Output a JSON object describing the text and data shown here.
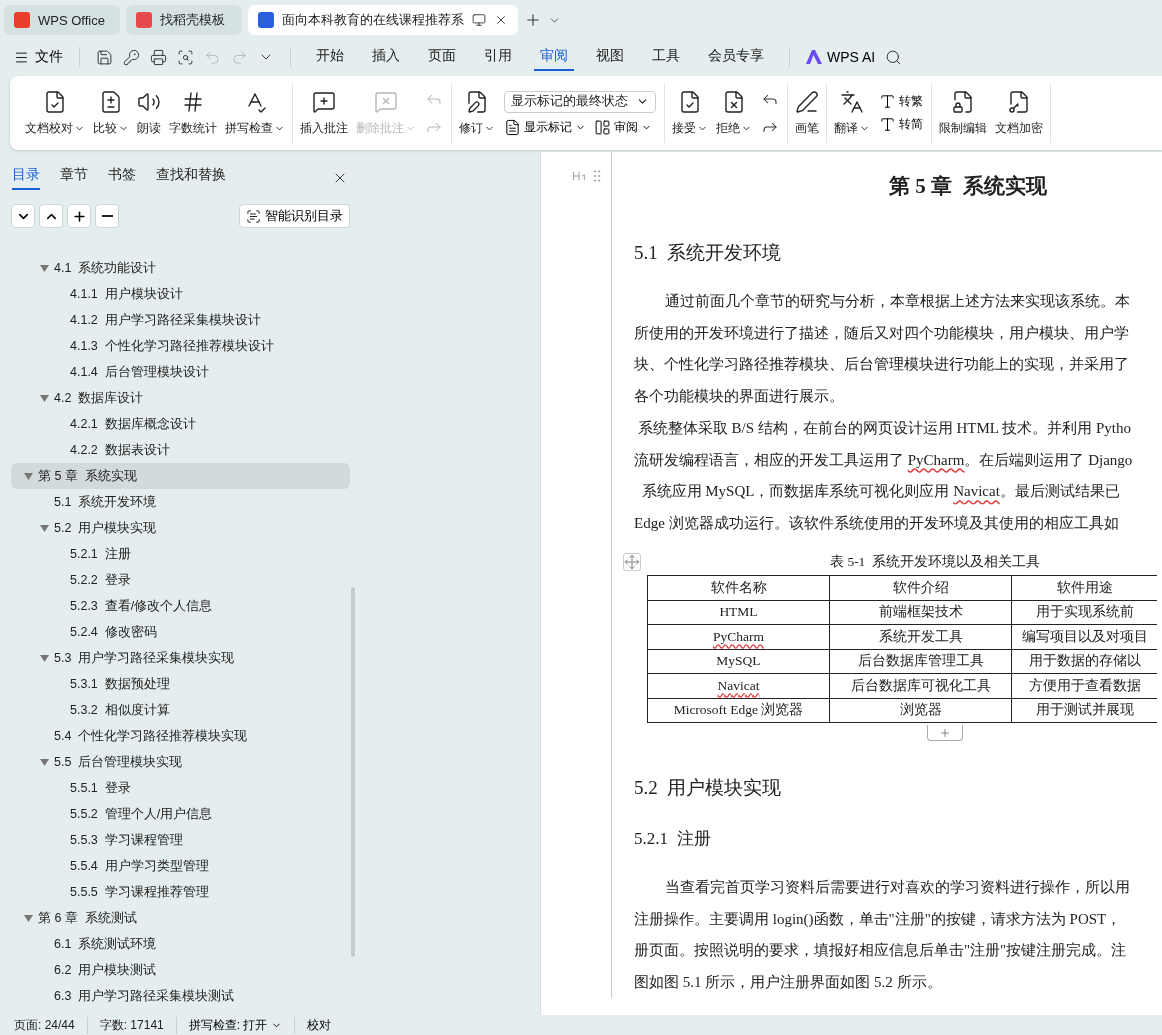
{
  "app_tabs": [
    {
      "label": "WPS Office",
      "kind": "home",
      "selected": false
    },
    {
      "label": "找稻壳模板",
      "kind": "template",
      "selected": false
    },
    {
      "label": "面向本科教育的在线课程推荐系",
      "kind": "document",
      "selected": true
    }
  ],
  "menu": {
    "file": "文件",
    "tabs": [
      {
        "label": "开始",
        "selected": false
      },
      {
        "label": "插入",
        "selected": false
      },
      {
        "label": "页面",
        "selected": false
      },
      {
        "label": "引用",
        "selected": false
      },
      {
        "label": "审阅",
        "selected": true
      },
      {
        "label": "视图",
        "selected": false
      },
      {
        "label": "工具",
        "selected": false
      },
      {
        "label": "会员专享",
        "selected": false
      }
    ],
    "ai": "WPS AI"
  },
  "ribbon": [
    {
      "items": [
        {
          "kind": "large",
          "label": "文档校对",
          "dropdown": true,
          "disabled": false
        },
        {
          "kind": "large",
          "label": "比较",
          "dropdown": true,
          "disabled": false
        },
        {
          "kind": "large",
          "label": "朗读",
          "dropdown": false,
          "disabled": false
        },
        {
          "kind": "large",
          "label": "字数统计",
          "dropdown": false,
          "disabled": false
        },
        {
          "kind": "large",
          "label": "拼写检查",
          "dropdown": true,
          "disabled": false
        }
      ]
    },
    {
      "items": [
        {
          "kind": "large",
          "label": "插入批注",
          "dropdown": false,
          "disabled": false
        },
        {
          "kind": "large",
          "label": "删除批注",
          "dropdown": true,
          "disabled": true
        },
        {
          "kind": "pair",
          "disabled": true
        }
      ]
    },
    {
      "items": [
        {
          "kind": "large",
          "label": "修订",
          "dropdown": true,
          "disabled": false
        },
        {
          "kind": "stack",
          "rows": [
            [
              {
                "kind": "select",
                "value": "显示标记的最终状态"
              }
            ],
            [
              {
                "kind": "small",
                "label": "显示标记",
                "dropdown": true
              },
              {
                "kind": "small",
                "label": "审阅",
                "dropdown": true
              }
            ]
          ]
        }
      ]
    },
    {
      "items": [
        {
          "kind": "large",
          "label": "接受",
          "dropdown": true,
          "disabled": false
        },
        {
          "kind": "large",
          "label": "拒绝",
          "dropdown": true,
          "disabled": false
        },
        {
          "kind": "pair",
          "disabled": false
        }
      ]
    },
    {
      "items": [
        {
          "kind": "large",
          "label": "画笔",
          "dropdown": false,
          "disabled": false
        }
      ]
    },
    {
      "items": [
        {
          "kind": "large",
          "label": "翻译",
          "dropdown": true,
          "disabled": false
        },
        {
          "kind": "stack",
          "rows": [
            [
              {
                "kind": "small",
                "label": "转繁",
                "dropdown": false
              }
            ],
            [
              {
                "kind": "small",
                "label": "转简",
                "dropdown": false
              }
            ]
          ]
        }
      ]
    },
    {
      "items": [
        {
          "kind": "large",
          "label": "限制编辑",
          "dropdown": false,
          "disabled": false
        },
        {
          "kind": "large",
          "label": "文档加密",
          "dropdown": false,
          "disabled": false
        }
      ]
    }
  ],
  "sidebar": {
    "tabs": [
      {
        "label": "目录",
        "selected": true
      },
      {
        "label": "章节",
        "selected": false
      },
      {
        "label": "书签",
        "selected": false
      },
      {
        "label": "查找和替换",
        "selected": false
      }
    ],
    "smart_button": "智能识别目录",
    "toc": [
      {
        "children": [
          {
            "label": "4.1  系统功能设计",
            "expanded": true,
            "selected": false,
            "children": [
              {
                "label": "4.1.1  用户模块设计",
                "selected": false
              },
              {
                "label": "4.1.2  用户学习路径采集模块设计",
                "selected": false
              },
              {
                "label": "4.1.3  个性化学习路径推荐模块设计",
                "selected": false
              },
              {
                "label": "4.1.4  后台管理模块设计",
                "selected": false
              }
            ]
          },
          {
            "label": "4.2  数据库设计",
            "expanded": true,
            "selected": false,
            "children": [
              {
                "label": "4.2.1  数据库概念设计",
                "selected": false
              },
              {
                "label": "4.2.2  数据表设计",
                "selected": false
              }
            ]
          }
        ]
      },
      {
        "label": "第 5 章  系统实现",
        "expanded": true,
        "selected": true,
        "children": [
          {
            "label": "5.1  系统开发环境",
            "selected": false
          },
          {
            "label": "5.2  用户模块实现",
            "expanded": true,
            "selected": false,
            "children": [
              {
                "label": "5.2.1  注册",
                "selected": false
              },
              {
                "label": "5.2.2  登录",
                "selected": false
              },
              {
                "label": "5.2.3  查看/修改个人信息",
                "selected": false
              },
              {
                "label": "5.2.4  修改密码",
                "selected": false
              }
            ]
          },
          {
            "label": "5.3  用户学习路径采集模块实现",
            "expanded": true,
            "selected": false,
            "children": [
              {
                "label": "5.3.1  数据预处理",
                "selected": false
              },
              {
                "label": "5.3.2  相似度计算",
                "selected": false
              }
            ]
          },
          {
            "label": "5.4  个性化学习路径推荐模块实现",
            "selected": false
          },
          {
            "label": "5.5  后台管理模块实现",
            "expanded": true,
            "selected": false,
            "children": [
              {
                "label": "5.5.1  登录",
                "selected": false
              },
              {
                "label": "5.5.2  管理个人/用户信息",
                "selected": false
              },
              {
                "label": "5.5.3  学习课程管理",
                "selected": false
              },
              {
                "label": "5.5.4  用户学习类型管理",
                "selected": false
              },
              {
                "label": "5.5.5  学习课程推荐管理",
                "selected": false
              }
            ]
          }
        ]
      },
      {
        "label": "第 6 章  系统测试",
        "expanded": true,
        "selected": false,
        "children": [
          {
            "label": "6.1  系统测试环境",
            "selected": false
          },
          {
            "label": "6.2  用户模块测试",
            "selected": false
          },
          {
            "label": "6.3  用户学习路径采集模块测试",
            "selected": false
          }
        ]
      }
    ]
  },
  "document": {
    "blocks": [
      {
        "kind": "chapter",
        "text": "第 5 章  系统实现"
      },
      {
        "kind": "section",
        "text": "5.1  系统开发环境"
      },
      {
        "kind": "paragraph",
        "lines": [
          {
            "indent": true,
            "segments": [
              {
                "text": "通过前面几个章节的研究与分析，本章根据上述方法来实现该系统。本"
              }
            ]
          },
          {
            "segments": [
              {
                "text": "所使用的开发环境进行了描述，随后又对四个功能模块，用户模块、用户学"
              }
            ]
          },
          {
            "segments": [
              {
                "text": "块、个性化学习路径推荐模块、后台管理模块进行功能上的实现，并采用了"
              }
            ]
          },
          {
            "segments": [
              {
                "text": "各个功能模块的界面进行展示。"
              }
            ]
          }
        ]
      },
      {
        "kind": "paragraph",
        "lines": [
          {
            "segments": [
              {
                "text": " 系统整体采取 B/S 结构，在前台的网页设计运用 HTML 技术。并利用 Pytho"
              }
            ]
          },
          {
            "segments": [
              {
                "text": "流研发编程语言，相应的开发工具运用了 "
              },
              {
                "text": "PyCharm",
                "misspelled": true
              },
              {
                "text": "。在后端则运用了 Django"
              }
            ]
          },
          {
            "segments": [
              {
                "text": "  系统应用 MySQL，而数据库系统可视化则应用 "
              },
              {
                "text": "Navicat",
                "misspelled": true
              },
              {
                "text": "。最后测试结果已"
              }
            ]
          },
          {
            "segments": [
              {
                "text": "Edge 浏览器成功运行。该软件系统使用的开发环境及其使用的相应工具如"
              }
            ]
          }
        ]
      },
      {
        "kind": "table",
        "caption": "表 5-1  系统开发环境以及相关工具",
        "columns": [
          "软件名称",
          "软件介绍",
          "软件用途"
        ],
        "rows": [
          [
            {
              "text": "HTML",
              "misspelled": false
            },
            {
              "text": "前端框架技术",
              "misspelled": false
            },
            {
              "text": "用于实现系统前",
              "misspelled": false
            }
          ],
          [
            {
              "text": "PyCharm",
              "misspelled": true
            },
            {
              "text": "系统开发工具",
              "misspelled": false
            },
            {
              "text": "编写项目以及对项目",
              "misspelled": false
            }
          ],
          [
            {
              "text": "MySQL",
              "misspelled": false
            },
            {
              "text": "后台数据库管理工具",
              "misspelled": false
            },
            {
              "text": "用于数据的存储以",
              "misspelled": false
            }
          ],
          [
            {
              "text": "Navicat",
              "misspelled": true
            },
            {
              "text": "后台数据库可视化工具",
              "misspelled": false
            },
            {
              "text": "方便用于查看数据",
              "misspelled": false
            }
          ],
          [
            {
              "text": "Microsoft Edge 浏览器",
              "misspelled": false
            },
            {
              "text": "浏览器",
              "misspelled": false
            },
            {
              "text": "用于测试并展现",
              "misspelled": false
            }
          ]
        ]
      },
      {
        "kind": "section",
        "text": "5.2  用户模块实现"
      },
      {
        "kind": "subsection",
        "text": "5.2.1  注册"
      },
      {
        "kind": "paragraph",
        "lines": [
          {
            "indent": true,
            "segments": [
              {
                "text": "当查看完首页学习资料后需要进行对喜欢的学习资料进行操作，所以用"
              }
            ]
          },
          {
            "segments": [
              {
                "text": "注册操作。主要调用 login()函数，单击\"注册\"的按键，请求方法为 POST，"
              }
            ]
          },
          {
            "segments": [
              {
                "text": "册页面。按照说明的要求，填报好相应信息后单击\"注册\"按键注册完成。注"
              }
            ]
          },
          {
            "segments": [
              {
                "text": "图如图 5.1 所示，用户注册界面如图 5.2 所示。"
              }
            ]
          }
        ]
      }
    ]
  },
  "status_bar": {
    "page": "页面: 24/44",
    "words": "字数: 17141",
    "spell": "拼写检查: 打开",
    "proof": "校对"
  }
}
